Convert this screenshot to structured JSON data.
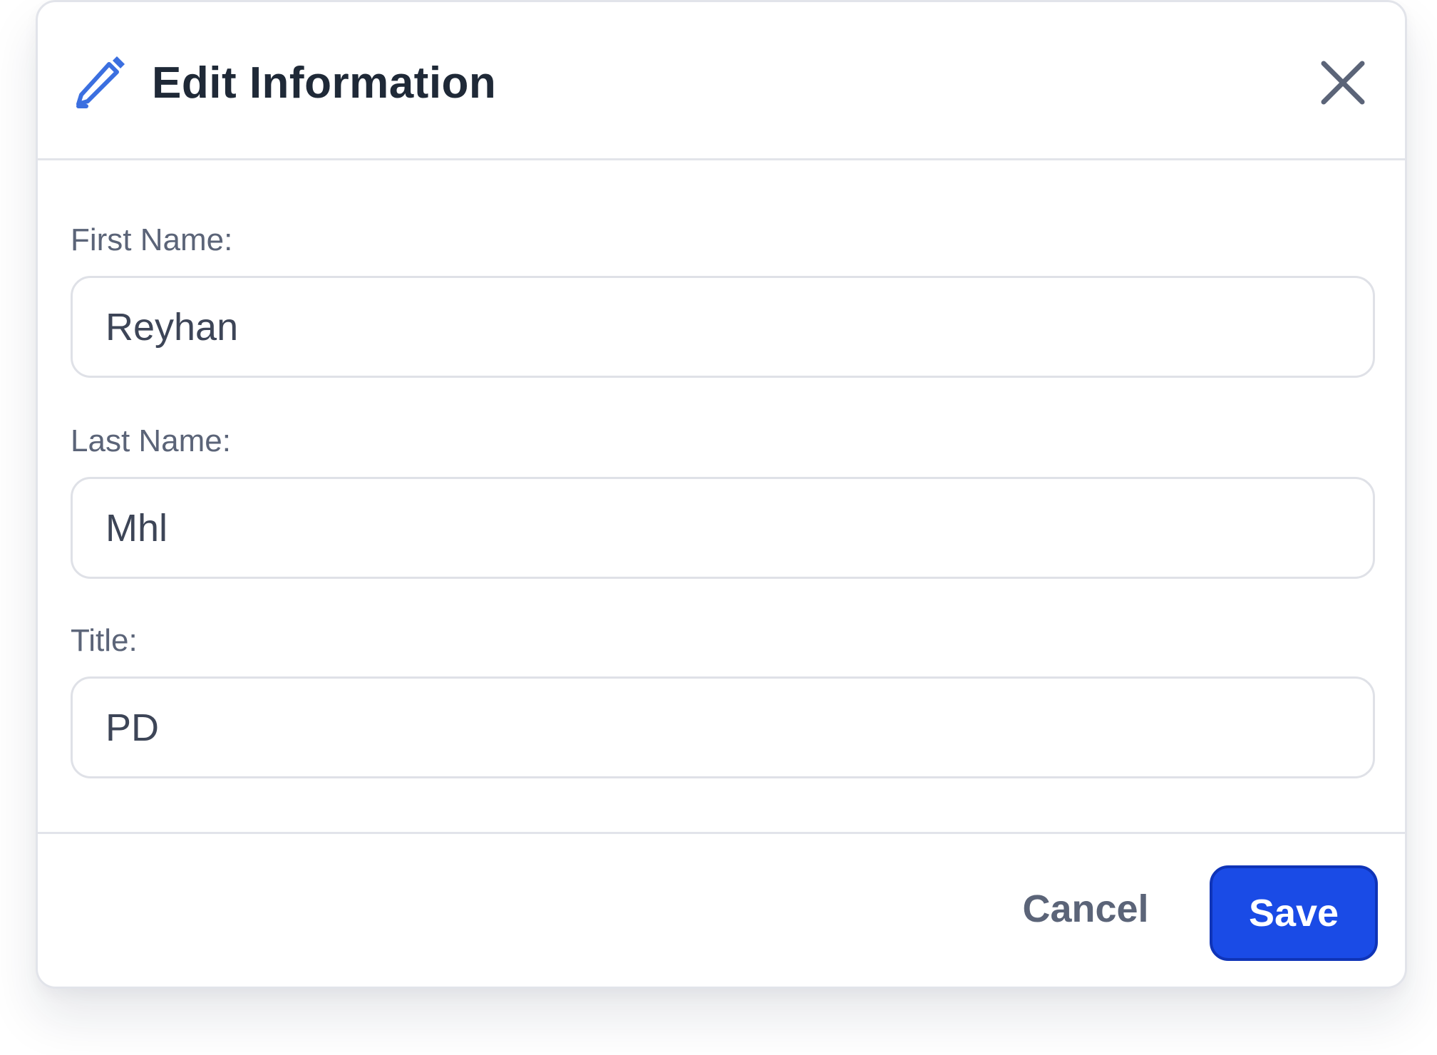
{
  "dialog": {
    "title": "Edit Information",
    "header_icon": "pencil-icon",
    "close_icon": "close-icon"
  },
  "form": {
    "fields": [
      {
        "label": "First Name:",
        "value": "Reyhan"
      },
      {
        "label": "Last Name:",
        "value": "Mhl"
      },
      {
        "label": "Title:",
        "value": "PD"
      }
    ]
  },
  "footer": {
    "cancel_label": "Cancel",
    "save_label": "Save"
  },
  "colors": {
    "accent": "#1a4be6",
    "icon": "#3b6fe0",
    "title_text": "#1f2937",
    "label_text": "#5b6478",
    "border": "#e2e4ea"
  }
}
